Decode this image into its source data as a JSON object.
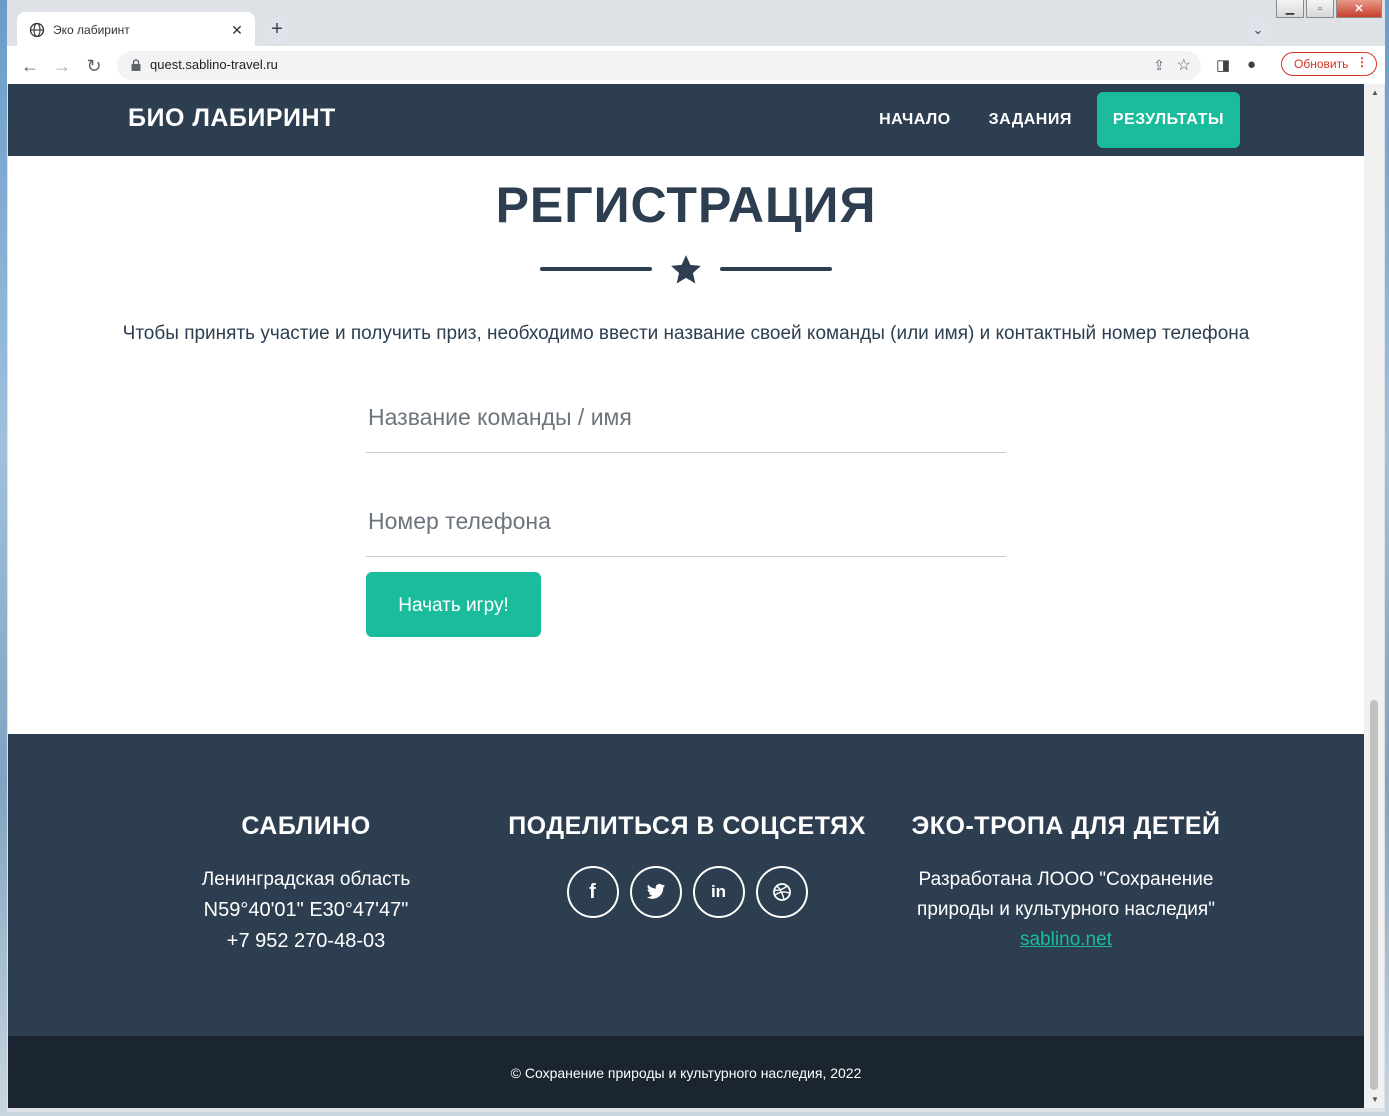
{
  "browser": {
    "tab_title": "Эко лабиринт",
    "url": "quest.sablino-travel.ru",
    "update_label": "Обновить"
  },
  "site": {
    "brand": "БИО ЛАБИРИНТ",
    "nav": [
      "НАЧАЛО",
      "ЗАДАНИЯ",
      "РЕЗУЛЬТАТЫ"
    ],
    "active_nav": "РЕЗУЛЬТАТЫ",
    "accent_color": "#1abc9c",
    "primary_color": "#2c3e50"
  },
  "registration": {
    "title": "РЕГИСТРАЦИЯ",
    "intro": "Чтобы принять участие и получить приз, необходимо ввести название своей команды (или имя) и контактный номер телефона",
    "team_placeholder": "Название команды / имя",
    "phone_placeholder": "Номер телефона",
    "submit_label": "Начать игру!"
  },
  "footer": {
    "col1": {
      "title": "САБЛИНО",
      "line1": "Ленинградская область",
      "line2": "N59°40'01\" E30°47'47\"",
      "line3": "+7 952 270-48-03"
    },
    "col2": {
      "title": "ПОДЕЛИТЬСЯ В СОЦСЕТЯХ",
      "icons": [
        "facebook-icon",
        "twitter-icon",
        "linkedin-icon",
        "dribbble-icon"
      ]
    },
    "col3": {
      "title": "ЭКО-ТРОПА ДЛЯ ДЕТЕЙ",
      "line1": "Разработана ЛООО \"Сохранение",
      "line2": "природы и культурного наследия\"",
      "link": "sablino.net"
    },
    "copyright": "© Сохранение природы и культурного наследия, 2022"
  }
}
